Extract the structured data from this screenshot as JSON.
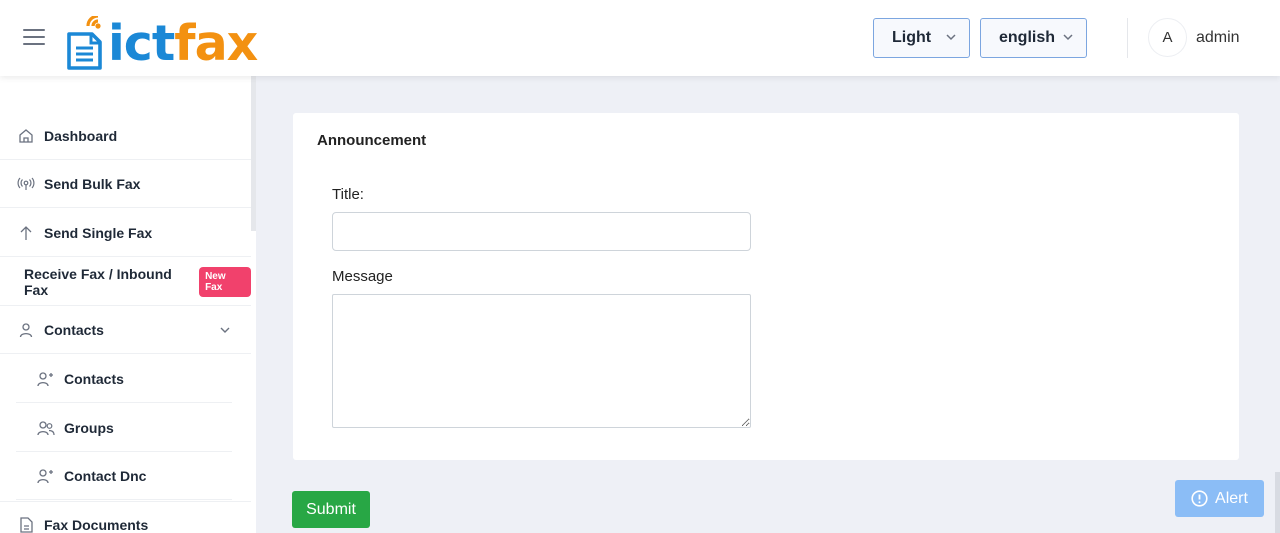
{
  "header": {
    "menu_icon": "hamburger-icon",
    "logo": {
      "part1": "ict",
      "part2": "fax",
      "color_ict": "#1b88d6",
      "color_fax": "#f39111"
    },
    "theme_select": {
      "value": "Light"
    },
    "language_select": {
      "value": "english"
    },
    "user": {
      "avatar_initial": "A",
      "name": "admin"
    }
  },
  "sidebar": {
    "items": [
      {
        "label": "Dashboard",
        "icon": "home-icon"
      },
      {
        "label": "Send Bulk Fax",
        "icon": "broadcast-icon"
      },
      {
        "label": "Send Single Fax",
        "icon": "arrow-up-icon"
      },
      {
        "label": "Receive Fax / Inbound Fax",
        "badge": "New Fax"
      },
      {
        "label": "Contacts",
        "icon": "user-icon",
        "expanded": true,
        "children": [
          {
            "label": "Contacts",
            "icon": "user-plus-icon"
          },
          {
            "label": "Groups",
            "icon": "users-icon"
          },
          {
            "label": "Contact Dnc",
            "icon": "user-plus-icon"
          }
        ]
      },
      {
        "label": "Fax Documents",
        "icon": "document-icon"
      }
    ]
  },
  "main": {
    "card_title": "Announcement",
    "form": {
      "title_label": "Title:",
      "title_value": "",
      "message_label": "Message",
      "message_value": ""
    },
    "submit_label": "Submit",
    "alert_label": "Alert"
  },
  "colors": {
    "submit": "#28a745",
    "alert": "#8bbdf6",
    "badge": "#f1416c",
    "background": "#eef0f6"
  }
}
